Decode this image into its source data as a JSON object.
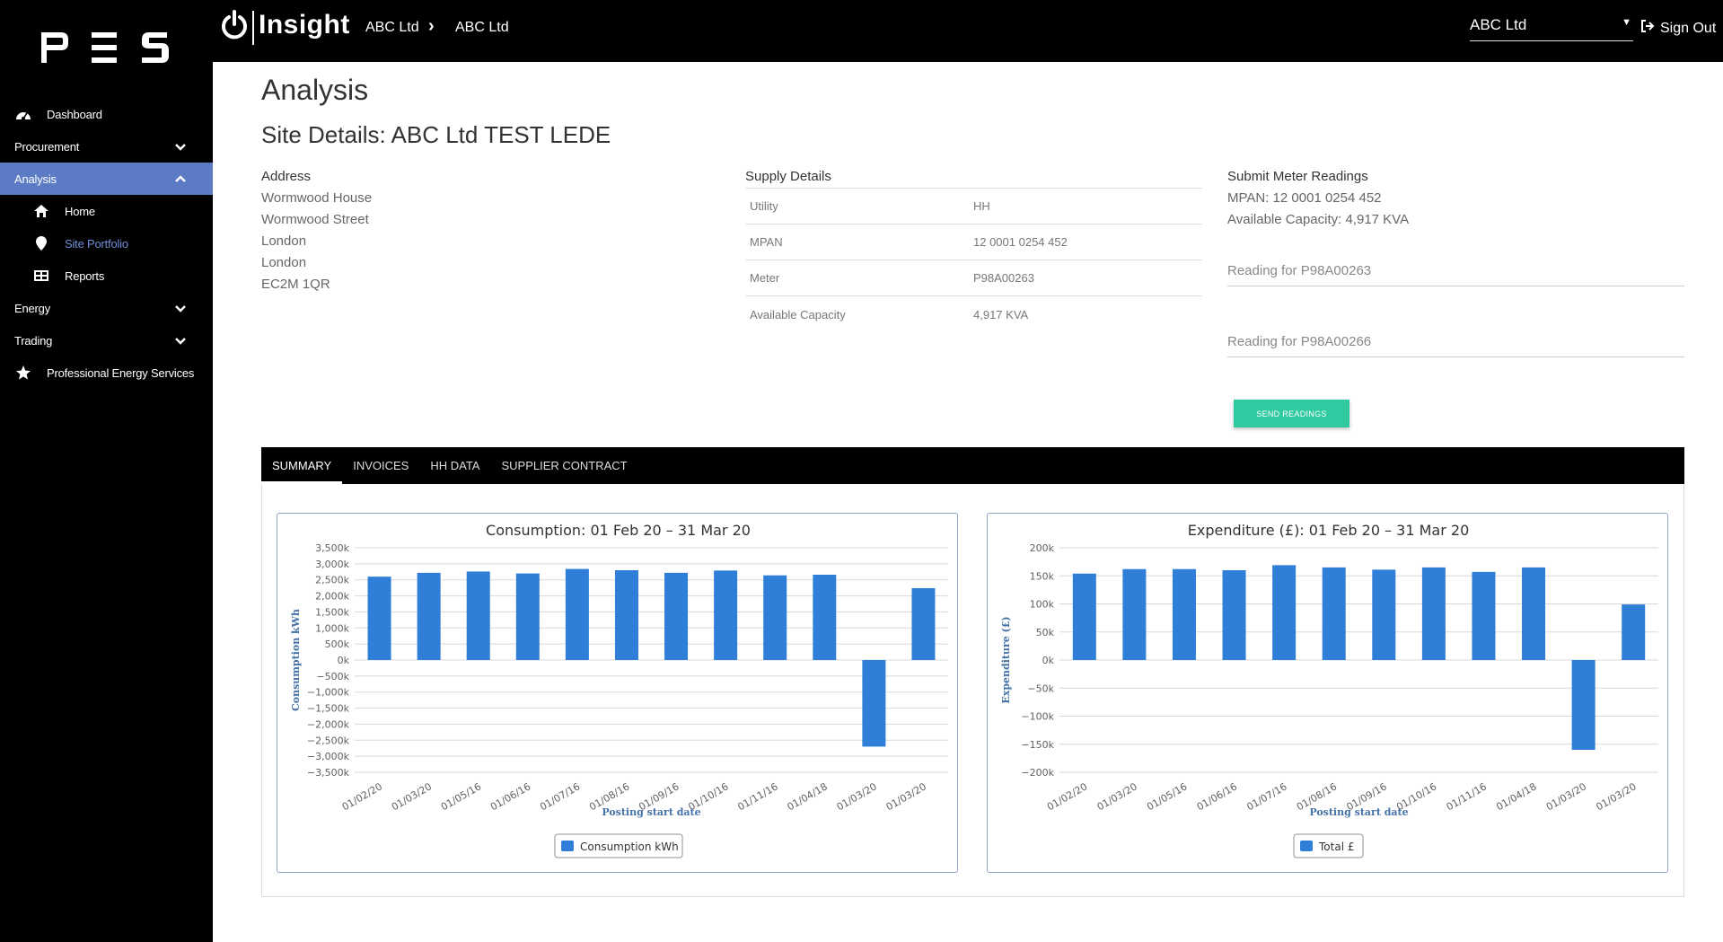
{
  "header": {
    "app_name": "Insight",
    "breadcrumb": [
      "ABC Ltd",
      "ABC Ltd"
    ],
    "company_select": "ABC Ltd",
    "sign_out": "Sign Out"
  },
  "sidebar": {
    "logo": "PES",
    "items": [
      {
        "label": "Dashboard",
        "icon": "dashboard-icon"
      },
      {
        "label": "Procurement",
        "icon": "chevron-down-icon"
      },
      {
        "label": "Analysis",
        "icon": "chevron-up-icon"
      },
      {
        "label": "Home",
        "icon": "home-icon"
      },
      {
        "label": "Site Portfolio",
        "icon": "map-pin-icon"
      },
      {
        "label": "Reports",
        "icon": "table-icon"
      },
      {
        "label": "Energy",
        "icon": "chevron-down-icon"
      },
      {
        "label": "Trading",
        "icon": "chevron-down-icon"
      },
      {
        "label": "Professional Energy Services",
        "icon": "star-icon"
      }
    ]
  },
  "page": {
    "title": "Analysis",
    "site_title": "Site Details: ABC Ltd TEST LEDE"
  },
  "address": {
    "title": "Address",
    "lines": [
      "Wormwood House",
      "Wormwood Street",
      "London",
      "London",
      "EC2M 1QR"
    ]
  },
  "supply": {
    "title": "Supply Details",
    "rows": [
      {
        "label": "Utility",
        "value": "HH"
      },
      {
        "label": "MPAN",
        "value": "12 0001 0254 452"
      },
      {
        "label": "Meter",
        "value": "P98A00263"
      },
      {
        "label": "Available Capacity",
        "value": "4,917 KVA"
      }
    ]
  },
  "meter": {
    "title": "Submit Meter Readings",
    "mpan": "MPAN: 12 0001 0254 452",
    "capacity": "Available Capacity: 4,917 KVA",
    "reading1_placeholder": "Reading for P98A00263",
    "reading2_placeholder": "Reading for P98A00266",
    "send_label": "SEND READINGS"
  },
  "tabs": [
    "SUMMARY",
    "INVOICES",
    "HH DATA",
    "SUPPLIER CONTRACT"
  ],
  "colors": {
    "accent": "#5b7bc4",
    "send_button": "#2fc9a2",
    "bar": "#2f7ed8",
    "axis_title": "#4572a7"
  },
  "chart_data": [
    {
      "type": "bar",
      "title": "Consumption: 01 Feb 20 – 31 Mar 20",
      "xlabel": "Posting start date",
      "ylabel": "Consumption kWh",
      "categories": [
        "01/02/20",
        "01/03/20",
        "01/05/16",
        "01/06/16",
        "01/07/16",
        "01/08/16",
        "01/09/16",
        "01/10/16",
        "01/11/16",
        "01/04/18",
        "01/03/20",
        "01/03/20"
      ],
      "series": [
        {
          "name": "Consumption kWh",
          "values": [
            2600,
            2720,
            2760,
            2700,
            2840,
            2800,
            2720,
            2790,
            2640,
            2660,
            -2700,
            2240
          ]
        }
      ],
      "ylim": [
        -3500,
        3500
      ],
      "yticks": [
        3500,
        3000,
        2500,
        2000,
        1500,
        1000,
        500,
        0,
        -500,
        -1000,
        -1500,
        -2000,
        -2500,
        -3000,
        -3500
      ],
      "ytick_labels": [
        "3,500k",
        "3,000k",
        "2,500k",
        "2,000k",
        "1,500k",
        "1,000k",
        "500k",
        "0k",
        "−500k",
        "−1,000k",
        "−1,500k",
        "−2,000k",
        "−2,500k",
        "−3,000k",
        "−3,500k"
      ],
      "legend_position": "bottom"
    },
    {
      "type": "bar",
      "title": "Expenditure (£): 01 Feb 20 – 31 Mar 20",
      "xlabel": "Posting start date",
      "ylabel": "Expenditure (£)",
      "categories": [
        "01/02/20",
        "01/03/20",
        "01/05/16",
        "01/06/16",
        "01/07/16",
        "01/08/16",
        "01/09/16",
        "01/10/16",
        "01/11/16",
        "01/04/18",
        "01/03/20",
        "01/03/20"
      ],
      "series": [
        {
          "name": "Total £",
          "values": [
            154,
            162,
            162,
            160,
            169,
            165,
            161,
            165,
            157,
            165,
            -160,
            99
          ]
        }
      ],
      "ylim": [
        -200,
        200
      ],
      "yticks": [
        200,
        150,
        100,
        50,
        0,
        -50,
        -100,
        -150,
        -200
      ],
      "ytick_labels": [
        "200k",
        "150k",
        "100k",
        "50k",
        "0k",
        "−50k",
        "−100k",
        "−150k",
        "−200k"
      ],
      "legend_position": "bottom"
    }
  ]
}
